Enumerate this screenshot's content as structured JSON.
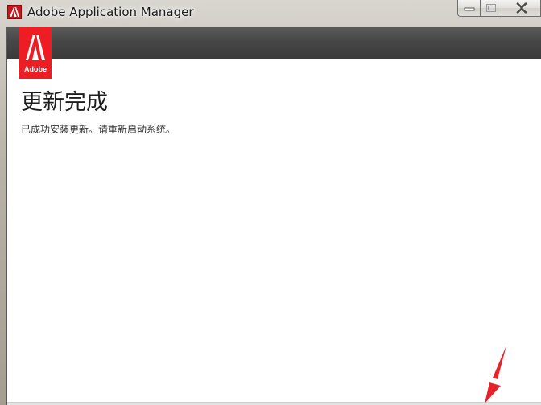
{
  "window": {
    "title": "Adobe Application Manager",
    "icon": "adobe-logo-icon",
    "controls": [
      {
        "name": "minimize-button",
        "icon": "minimize-icon"
      },
      {
        "name": "maximize-button",
        "icon": "maximize-icon"
      },
      {
        "name": "close-button",
        "icon": "close-icon"
      }
    ]
  },
  "brand": {
    "logo_text": "Adobe",
    "color": "#ee1d23"
  },
  "main": {
    "title": "更新完成",
    "message": "已成功安装更新。请重新启动系统。"
  },
  "annotation": {
    "icon": "red-arrow-icon",
    "color": "#e8222a"
  }
}
